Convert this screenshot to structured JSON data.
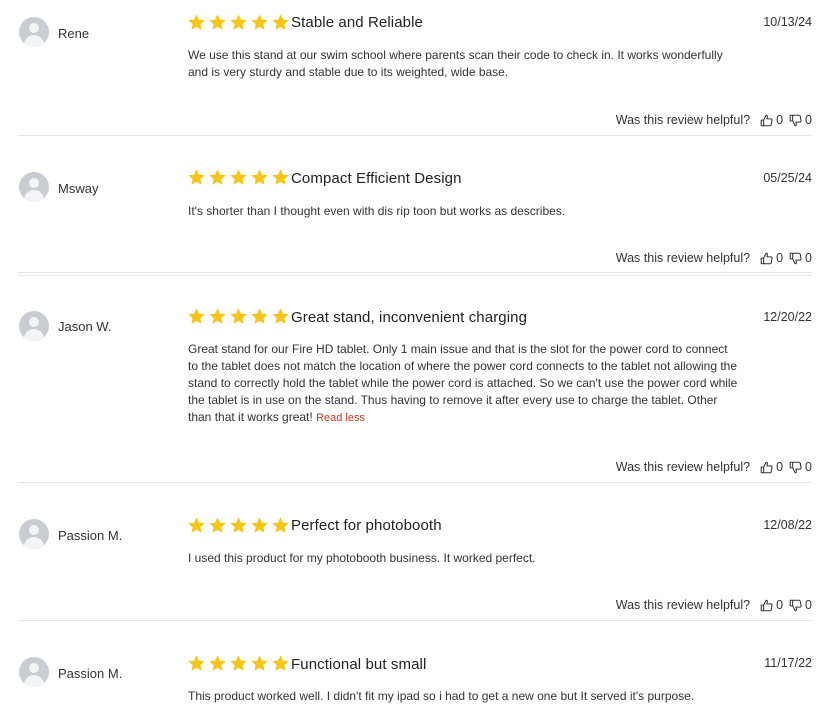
{
  "star_color": "#f5c518",
  "helpful_question": "Was this review helpful?",
  "reviews": [
    {
      "author": "Rene",
      "rating": 5,
      "title": "Stable and Reliable",
      "date": "10/13/24",
      "text": "We use this stand at our swim school where parents scan their code to check in. It works wonderfully and is very sturdy and stable due to its weighted, wide base.",
      "helpful_up": "0",
      "helpful_down": "0"
    },
    {
      "author": "Msway",
      "rating": 5,
      "title": "Compact Efficient Design",
      "date": "05/25/24",
      "text": "It's shorter than I thought even with dis rip toon but works as describes.",
      "helpful_up": "0",
      "helpful_down": "0"
    },
    {
      "author": "Jason W.",
      "rating": 5,
      "title": "Great stand, inconvenient charging",
      "date": "12/20/22",
      "text": "Great stand for our Fire HD tablet. Only 1 main issue and that is the slot for the power cord to connect to the tablet does not match the location of where the power cord connects to the tablet not allowing the stand to correctly hold the tablet while the power cord is attached. So we can't use the power cord while the tablet is in use on the stand. Thus having to remove it after every use to charge the tablet. Other than that it works great!",
      "read_less": "Read less",
      "helpful_up": "0",
      "helpful_down": "0"
    },
    {
      "author": "Passion M.",
      "rating": 5,
      "title": "Perfect for photobooth",
      "date": "12/08/22",
      "text": "I used this product for my photobooth business. It worked perfect.",
      "helpful_up": "0",
      "helpful_down": "0"
    },
    {
      "author": "Passion M.",
      "rating": 5,
      "title": "Functional but small",
      "date": "11/17/22",
      "text": "This product worked well. I didn't fit my ipad so i had to get a new one but It served it's purpose."
    }
  ]
}
